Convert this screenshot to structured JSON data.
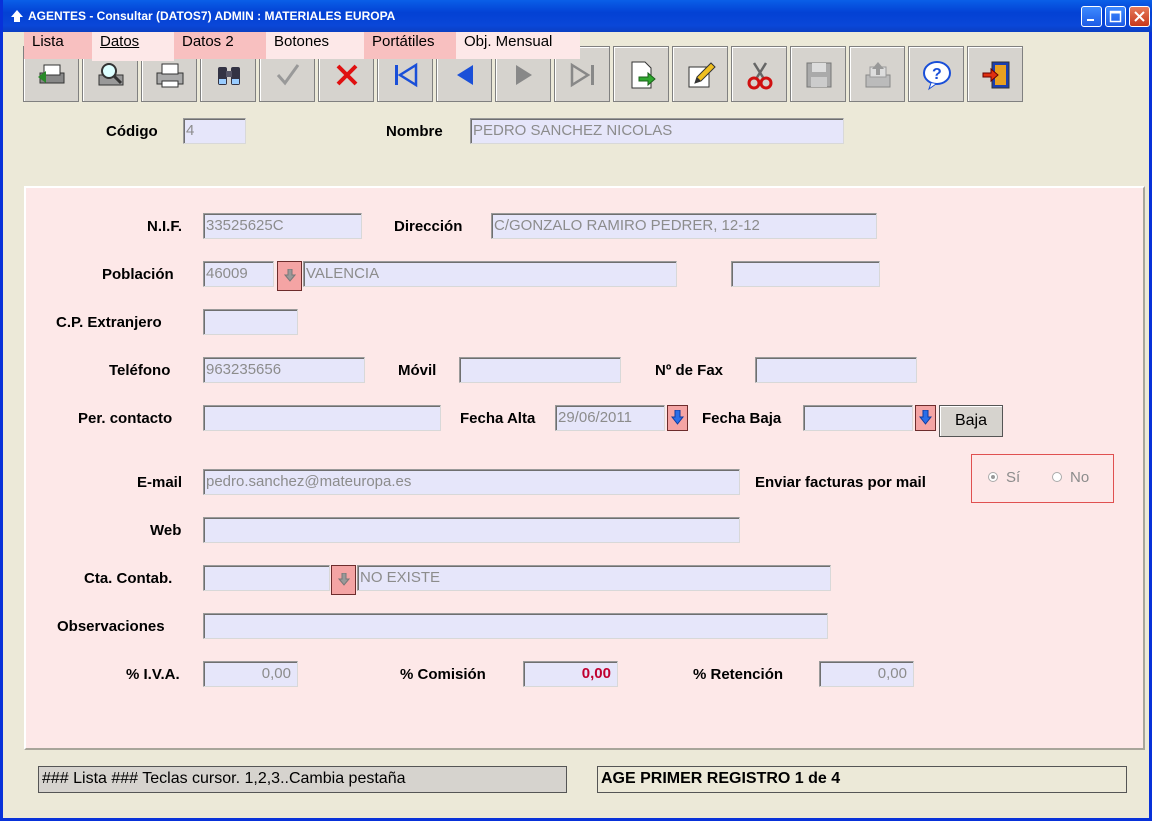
{
  "window": {
    "title": "AGENTES - Consultar (DATOS7) ADMIN : MATERIALES EUROPA"
  },
  "toolbar": {
    "buttons": [
      {
        "icon": "print-preview-icon"
      },
      {
        "icon": "search-preview-icon"
      },
      {
        "icon": "printer-icon"
      },
      {
        "icon": "binoculars-icon"
      },
      {
        "icon": "accept-check-icon"
      },
      {
        "icon": "cancel-x-icon"
      },
      {
        "icon": "first-record-icon"
      },
      {
        "icon": "previous-record-icon"
      },
      {
        "icon": "next-record-icon"
      },
      {
        "icon": "last-record-icon"
      },
      {
        "icon": "export-document-icon"
      },
      {
        "icon": "edit-pencil-icon"
      },
      {
        "icon": "cut-scissors-icon"
      },
      {
        "icon": "save-disk-icon"
      },
      {
        "icon": "upload-tray-icon"
      },
      {
        "icon": "help-icon"
      },
      {
        "icon": "exit-door-icon"
      }
    ]
  },
  "header": {
    "codigo_label": "Código",
    "codigo_value": "4",
    "nombre_label": "Nombre",
    "nombre_value": "PEDRO SANCHEZ NICOLAS"
  },
  "tabs": [
    "Lista",
    "Datos",
    "Datos 2",
    "Botones",
    "Portátiles",
    "Obj. Mensual"
  ],
  "form": {
    "nif_label": "N.I.F.",
    "nif": "33525625C",
    "direccion_label": "Dirección",
    "direccion": "C/GONZALO RAMIRO PEDRER, 12-12",
    "poblacion_label": "Población",
    "cp": "46009",
    "poblacion": "VALENCIA",
    "poblacion_extra": "",
    "cp_ext_label": "C.P. Extranjero",
    "cp_ext": "",
    "telefono_label": "Teléfono",
    "telefono": "963235656",
    "movil_label": "Móvil",
    "movil": "",
    "fax_label": "Nº de Fax",
    "fax": "",
    "contacto_label": "Per. contacto",
    "contacto": "",
    "fecha_alta_label": "Fecha Alta",
    "fecha_alta": "29/06/2011",
    "fecha_baja_label": "Fecha Baja",
    "fecha_baja": "",
    "baja_button": "Baja",
    "email_label": "E-mail",
    "email": "pedro.sanchez@mateuropa.es",
    "enviar_label": "Enviar facturas por mail",
    "radio_si": "Sí",
    "radio_no": "No",
    "radio_selected": "Sí",
    "web_label": "Web",
    "web": "",
    "cta_label": "Cta. Contab.",
    "cta": "",
    "cta_desc": "NO EXISTE",
    "obs_label": "Observaciones",
    "obs": "",
    "iva_label": "% I.V.A.",
    "iva": "0,00",
    "comision_label": "% Comisión",
    "comision": "0,00",
    "retencion_label": "% Retención",
    "retencion": "0,00"
  },
  "statusbar": {
    "left": "### Lista ### Teclas cursor. 1,2,3..Cambia pestaña",
    "right": "AGE PRIMER REGISTRO 1 de 4"
  },
  "colors": {
    "titlebar": "#0a47d8",
    "panel_bg": "#fde8e8",
    "field_bg": "#e6e6fa",
    "tab_pink": "#f8c0c0",
    "accent_red": "#c00030"
  }
}
